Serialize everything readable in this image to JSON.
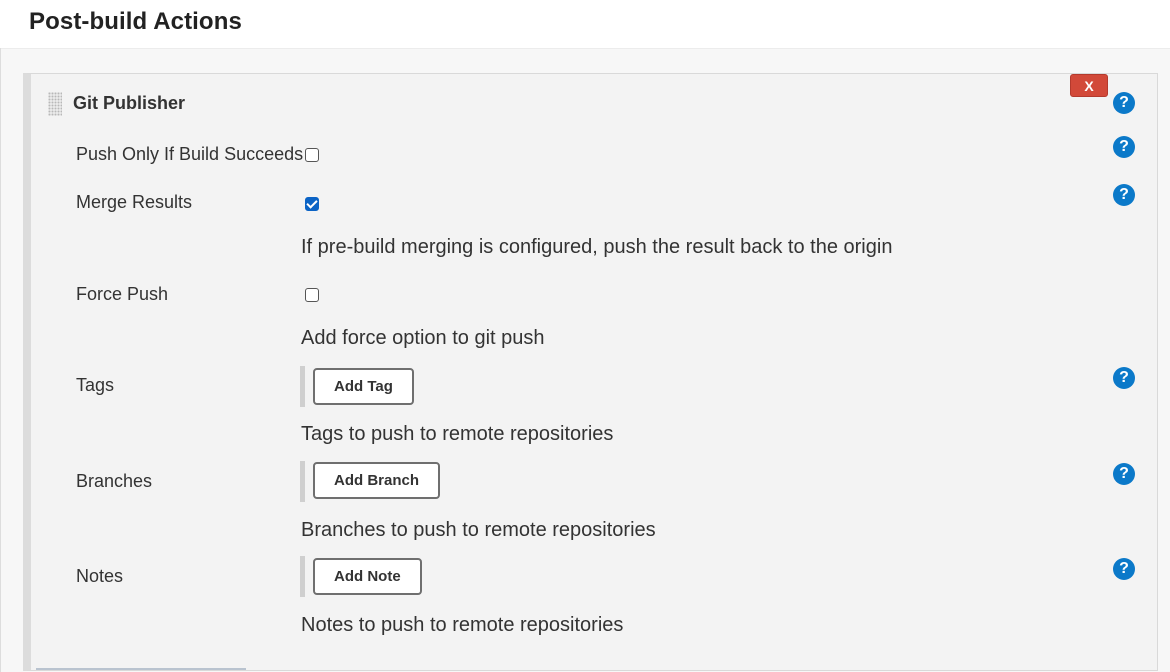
{
  "section": {
    "title": "Post-build Actions"
  },
  "publisher": {
    "title": "Git Publisher",
    "delete_label": "X"
  },
  "help": {
    "glyph": "?"
  },
  "fields": {
    "push_only": {
      "label": "Push Only If Build Succeeds",
      "checked": false
    },
    "merge_results": {
      "label": "Merge Results",
      "checked": true,
      "description": "If pre-build merging is configured, push the result back to the origin"
    },
    "force_push": {
      "label": "Force Push",
      "checked": false,
      "description": "Add force option to git push"
    },
    "tags": {
      "label": "Tags",
      "button": "Add Tag",
      "description": "Tags to push to remote repositories"
    },
    "branches": {
      "label": "Branches",
      "button": "Add Branch",
      "description": "Branches to push to remote repositories"
    },
    "notes": {
      "label": "Notes",
      "button": "Add Note",
      "description": "Notes to push to remote repositories"
    }
  },
  "colors": {
    "help_blue": "#0b79c9",
    "delete_red": "#d24939",
    "checkbox_blue": "#0b63c5"
  },
  "icons": {
    "help": "question-circle-icon",
    "drag": "drag-handle-icon"
  }
}
